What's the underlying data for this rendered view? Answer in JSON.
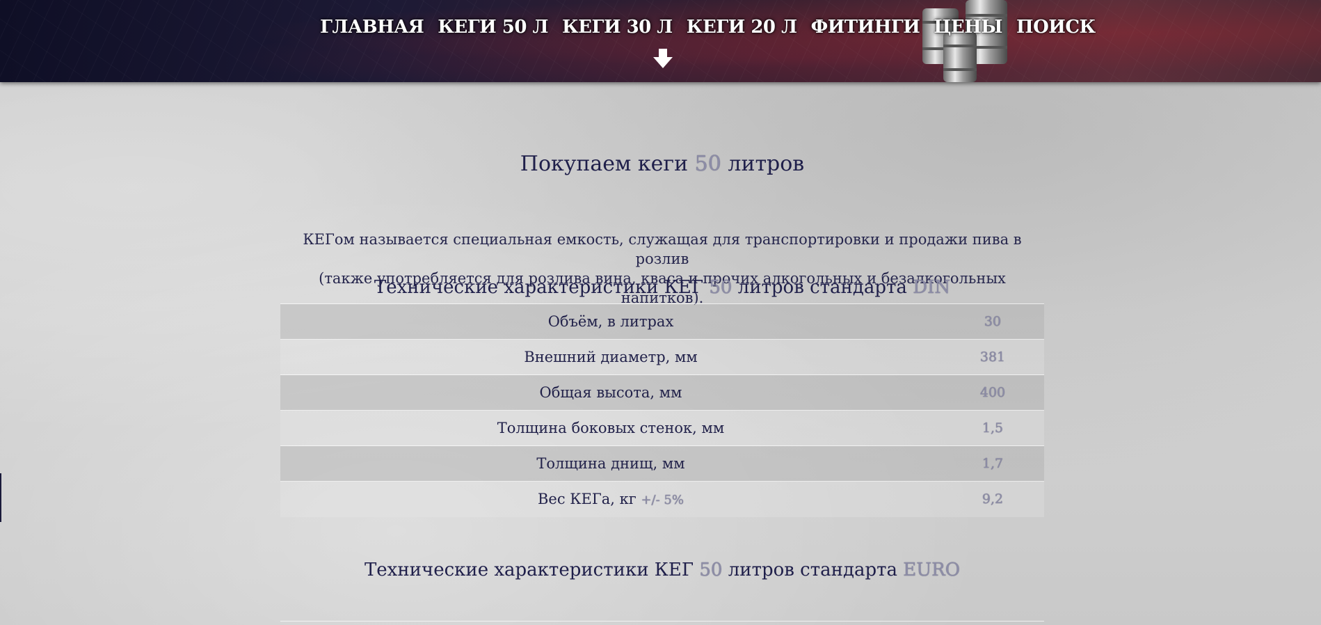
{
  "nav": {
    "items": [
      "ГЛАВНАЯ",
      "КЕГИ 50 Л",
      "КЕГИ 30 Л",
      "КЕГИ 20 Л",
      "ФИТИНГИ",
      "ЦЕНЫ",
      "ПОИСК"
    ]
  },
  "page": {
    "title_before": "Покупаем кеги ",
    "title_number": "50",
    "title_after": " литров",
    "intro_line1": "КЕГом называется специальная емкость, служащая для транспортировки и продажи пива в розлив",
    "intro_line2": "(также употребляется для розлива вина, кваса и прочих алкогольных и безалкогольных напитков).",
    "din_title_before": "Технические характеристики КЕГ ",
    "din_title_number": "50",
    "din_title_middle": " литров стандарта ",
    "din_title_standard": "DIN",
    "euro_title_before": "Технические характеристики КЕГ ",
    "euro_title_number": "50",
    "euro_title_middle": " литров стандарта ",
    "euro_title_standard": "EURO"
  },
  "specs": [
    {
      "label": "Объём, в литрах",
      "value": "30"
    },
    {
      "label": "Внешний диаметр, мм",
      "value": "381"
    },
    {
      "label": "Общая высота, мм",
      "value": "400"
    },
    {
      "label": "Толщина боковых стенок, мм",
      "value": "1,5"
    },
    {
      "label": "Толщина днищ, мм",
      "value": "1,7"
    },
    {
      "label": "Вес КЕГа, кг",
      "note": "+/- 5%",
      "value": "9,2"
    }
  ],
  "colors": {
    "text": "#1f1f4a",
    "accent_outline": "#8d8da7"
  }
}
